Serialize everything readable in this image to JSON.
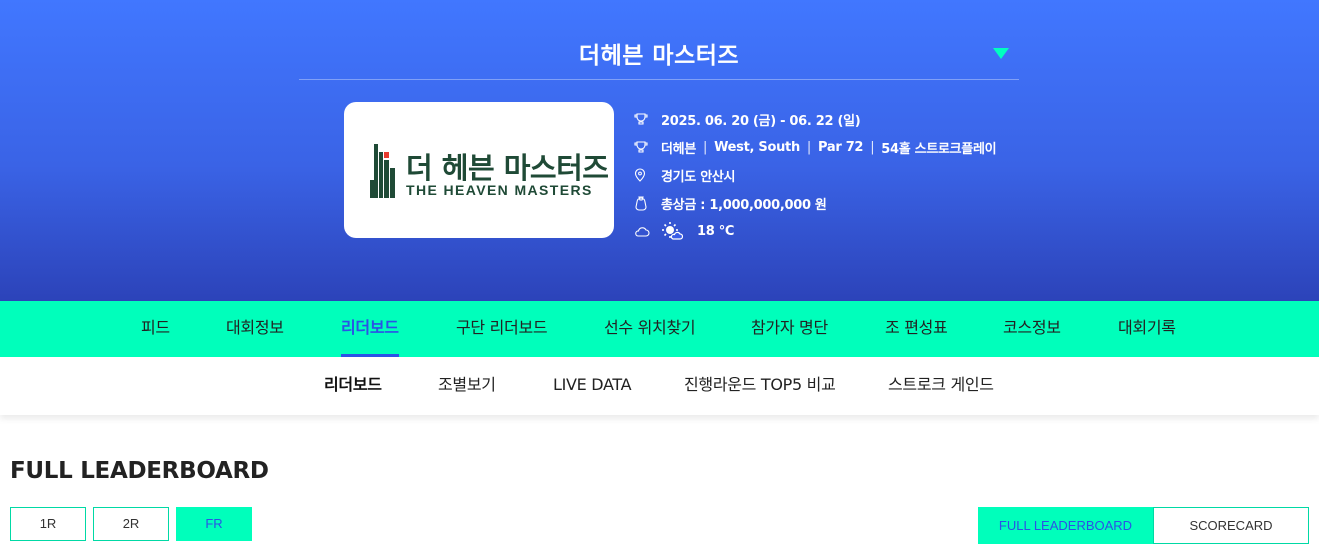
{
  "tournament": {
    "title": "더헤븐 마스터즈",
    "logo_ko": "더 헤븐 마스터즈",
    "logo_en": "THE HEAVEN MASTERS"
  },
  "info": {
    "date": "2025. 06. 20 (금) - 06. 22 (일)",
    "course": "더헤븐",
    "course_sep": "|",
    "holes_course": "West, South",
    "par": "Par 72",
    "format": "54홀 스트로크플레이",
    "location": "경기도 안산시",
    "prize": "총상금 : 1,000,000,000 원",
    "temperature": "18 °C"
  },
  "main_nav": {
    "items": [
      "피드",
      "대회정보",
      "리더보드",
      "구단 리더보드",
      "선수 위치찾기",
      "참가자 명단",
      "조 편성표",
      "코스정보",
      "대회기록"
    ],
    "active": "리더보드"
  },
  "sub_nav": {
    "items": [
      "리더보드",
      "조별보기",
      "LIVE DATA",
      "진행라운드 TOP5 비교",
      "스트로크 게인드"
    ],
    "active": "리더보드"
  },
  "content": {
    "heading": "FULL LEADERBOARD",
    "rounds": [
      "1R",
      "2R",
      "FR"
    ],
    "active_round": "FR",
    "view_tabs": [
      "FULL LEADERBOARD",
      "SCORECARD"
    ]
  },
  "colors": {
    "header_top": "#4177ff",
    "header_bottom": "#2c43b9",
    "accent_mint": "#00ffbb",
    "accent_blue": "#2b52e6",
    "logo_green": "#1f4a36"
  },
  "icons": {
    "dropdown": "triangle-down-icon",
    "date": "trophy-icon",
    "course": "trophy-icon",
    "location": "pin-icon",
    "prize": "money-bag-icon",
    "weather": "partly-cloudy-icon",
    "current_weather": "sun-cloud-icon"
  }
}
